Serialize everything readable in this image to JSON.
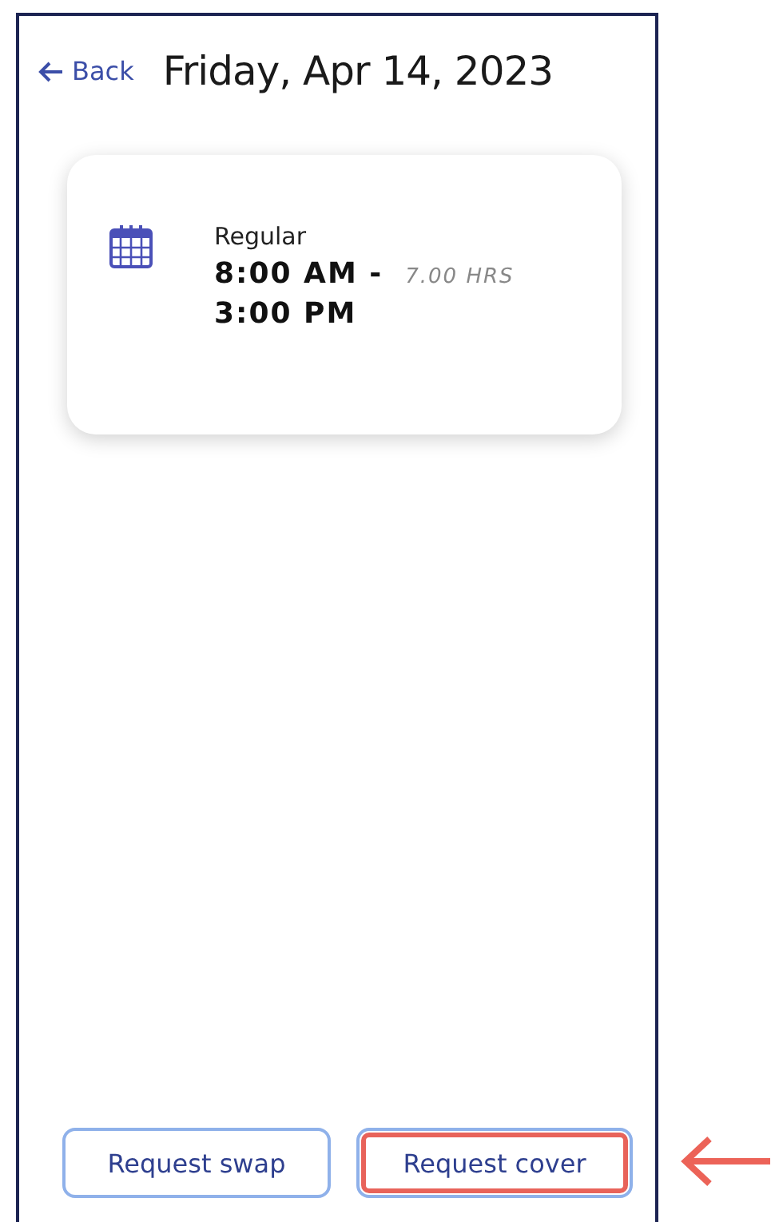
{
  "header": {
    "back_label": "Back",
    "title": "Friday, Apr 14, 2023"
  },
  "shift": {
    "type": "Regular",
    "start": "8:00 AM -",
    "end": "3:00 PM",
    "duration": "7.00 HRS"
  },
  "actions": [
    {
      "label": "Request swap",
      "highlighted": false
    },
    {
      "label": "Request cover",
      "highlighted": true
    }
  ]
}
